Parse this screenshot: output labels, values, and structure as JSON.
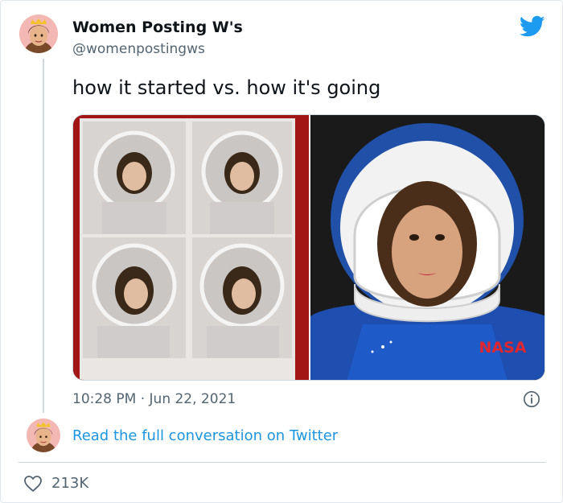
{
  "author": {
    "name": "Women Posting W's",
    "handle": "@womenpostingws"
  },
  "tweet": {
    "text": "how it started vs. how it's going",
    "timestamp": "10:28 PM · Jun 22, 2021"
  },
  "media": {
    "right_photo_patch_text": "NASA"
  },
  "footer": {
    "read_link": "Read the full conversation on Twitter",
    "like_count": "213K"
  },
  "colors": {
    "twitter_blue": "#1d9bf0",
    "link_blue": "#1b95e0",
    "secondary_text": "#536471"
  },
  "icons": {
    "brand": "twitter-bird-icon",
    "info": "info-icon",
    "like": "heart-outline-icon"
  }
}
